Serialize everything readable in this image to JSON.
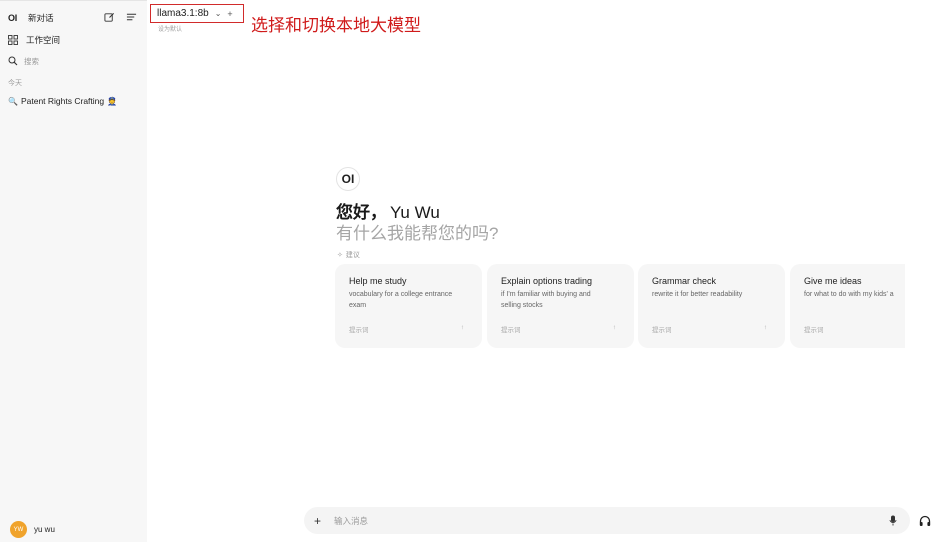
{
  "sidebar": {
    "logo": "OI",
    "new_chat": "新对话",
    "workspace": "工作空间",
    "search_placeholder": "搜索",
    "section_today": "今天",
    "chats": [
      {
        "label": "Patent Rights Crafting",
        "prefix_emoji": "🔍",
        "suffix_emoji": "👮"
      }
    ],
    "user": {
      "initials": "YW",
      "name": "yu wu"
    }
  },
  "topbar": {
    "model_name": "llama3.1:8b",
    "set_default": "设为默认",
    "annotation": "选择和切换本地大模型"
  },
  "main": {
    "logo": "OI",
    "greeting": "您好，",
    "user_name": "Yu Wu",
    "subtitle": "有什么我能帮您的吗?",
    "suggest_label": "建议",
    "cards": [
      {
        "title": "Help me study",
        "desc_line1": "vocabulary for a college entrance",
        "desc_line2": "exam",
        "foot": "提示词"
      },
      {
        "title": "Explain options trading",
        "desc_line1": "if I'm familiar with buying and",
        "desc_line2": "selling stocks",
        "foot": "提示词"
      },
      {
        "title": "Grammar check",
        "desc_line1": "rewrite it for better readability",
        "desc_line2": "",
        "foot": "提示词"
      },
      {
        "title": "Give me ideas",
        "desc_line1": "for what to do with my kids' a",
        "desc_line2": "",
        "foot": "提示词"
      }
    ]
  },
  "input": {
    "placeholder": "输入消息"
  },
  "colors": {
    "annotation_red": "#d01b1b",
    "avatar_orange": "#f0a32c",
    "sidebar_bg": "#f7f7f7"
  }
}
